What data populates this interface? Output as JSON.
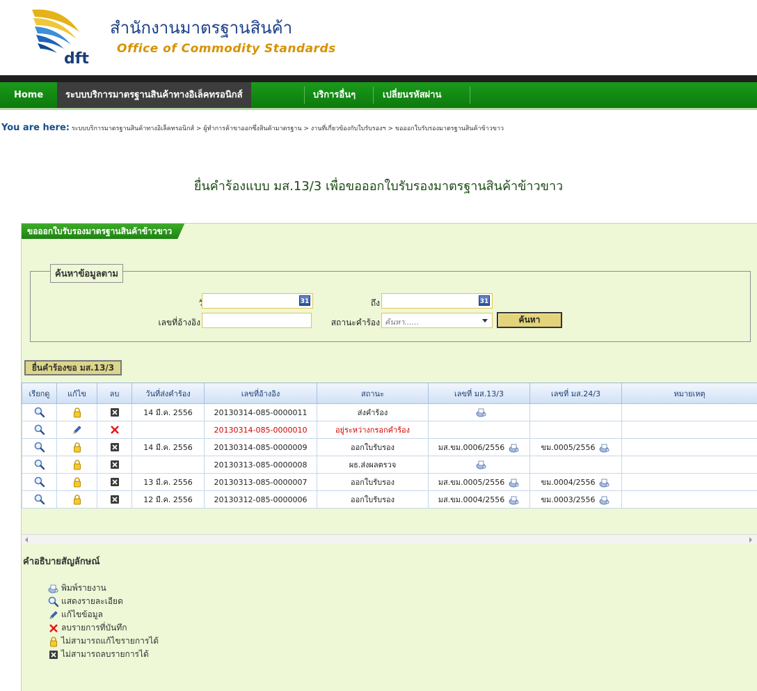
{
  "header": {
    "logo_text": "dft",
    "org_thai": "สำนักงานมาตรฐานสินค้า",
    "org_eng": "Office of Commodity Standards"
  },
  "nav": {
    "items": [
      {
        "label": "Home"
      },
      {
        "label": "ระบบบริการมาตรฐานสินค้าทางอิเล็คทรอนิกส์"
      },
      {
        "label": "บริการอื่นๆ"
      },
      {
        "label": "เปลี่ยนรหัสผ่าน"
      }
    ]
  },
  "breadcrumb": {
    "prefix": "You are here:",
    "path": "ระบบบริการมาตรฐานสินค้าทางอิเล็คทรอนิกส์ > ผู้ทำการค้าขาออกซึ่งสินค้ามาตรฐาน > งานที่เกี่ยวข้องกับใบรับรองฯ > ขอออกใบรับรองมาตรฐานสินค้าข้าวขาว"
  },
  "page_title": "ยื่นคำร้องแบบ มส.13/3 เพื่อขอออกใบรับรองมาตรฐานสินค้าข้าวขาว",
  "panel": {
    "tab_label": "ขอออกใบรับรองมาตรฐานสินค้าข้าวขาว",
    "search_legend": "ค้นหาข้อมูลตาม",
    "date_label": "วันที่",
    "to_label": "ถึง",
    "calendar_text": "31",
    "ref_label": "เลขที่อ้างอิง",
    "status_label": "สถานะคำร้อง",
    "status_placeholder": "ค้นหา......",
    "search_button": "ค้นหา",
    "create_button": "ยื่นคำร้องขอ มส.13/3"
  },
  "table": {
    "columns": [
      "เรียกดู",
      "แก้ไข",
      "ลบ",
      "วันที่ส่งคำร้อง",
      "เลขที่อ้างอิง",
      "สถานะ",
      "เลขที่ มส.13/3",
      "เลขที่ มส.24/3",
      "หมายเหตุ"
    ],
    "rows": [
      {
        "edit": "lock",
        "del": "xbox",
        "date": "14 มี.ค. 2556",
        "ref": "20130314-085-0000011",
        "status": "ส่งคำร้อง",
        "ms13": "",
        "ms13_print": true,
        "ms24": "",
        "ms24_print": false,
        "note": ""
      },
      {
        "edit": "pencil",
        "del": "redx",
        "date": "",
        "ref": "20130314-085-0000010",
        "status": "อยู่ระหว่างกรอกคำร้อง",
        "ms13": "",
        "ms13_print": false,
        "ms24": "",
        "ms24_print": false,
        "note": ""
      },
      {
        "edit": "lock",
        "del": "xbox",
        "date": "14 มี.ค. 2556",
        "ref": "20130314-085-0000009",
        "status": "ออกใบรับรอง",
        "ms13": "มส.ขม.0006/2556",
        "ms13_print": true,
        "ms24": "ขม.0005/2556",
        "ms24_print": true,
        "note": ""
      },
      {
        "edit": "lock",
        "del": "xbox",
        "date": "",
        "ref": "20130313-085-0000008",
        "status": "ผธ.ส่งผลตรวจ",
        "ms13": "",
        "ms13_print": true,
        "ms24": "",
        "ms24_print": false,
        "note": ""
      },
      {
        "edit": "lock",
        "del": "xbox",
        "date": "13 มี.ค. 2556",
        "ref": "20130313-085-0000007",
        "status": "ออกใบรับรอง",
        "ms13": "มส.ขม.0005/2556",
        "ms13_print": true,
        "ms24": "ขม.0004/2556",
        "ms24_print": true,
        "note": ""
      },
      {
        "edit": "lock",
        "del": "xbox",
        "date": "12 มี.ค. 2556",
        "ref": "20130312-085-0000006",
        "status": "ออกใบรับรอง",
        "ms13": "มส.ขม.0004/2556",
        "ms13_print": true,
        "ms24": "ขม.0003/2556",
        "ms24_print": true,
        "note": ""
      }
    ]
  },
  "legend": {
    "title": "คำอธิบายสัญลักษณ์",
    "items": [
      {
        "icon": "printer-icon",
        "label": "พิมพ์รายงาน"
      },
      {
        "icon": "magnifier-icon",
        "label": "แสดงรายละเอียด"
      },
      {
        "icon": "pencil-icon",
        "label": "แก้ไขข้อมูล"
      },
      {
        "icon": "red-x-icon",
        "label": "ลบรายการที่บันทึก"
      },
      {
        "icon": "lock-icon",
        "label": "ไม่สามารถแก้ไขรายการได้"
      },
      {
        "icon": "x-box-icon",
        "label": "ไม่สามารถลบรายการได้"
      }
    ]
  }
}
